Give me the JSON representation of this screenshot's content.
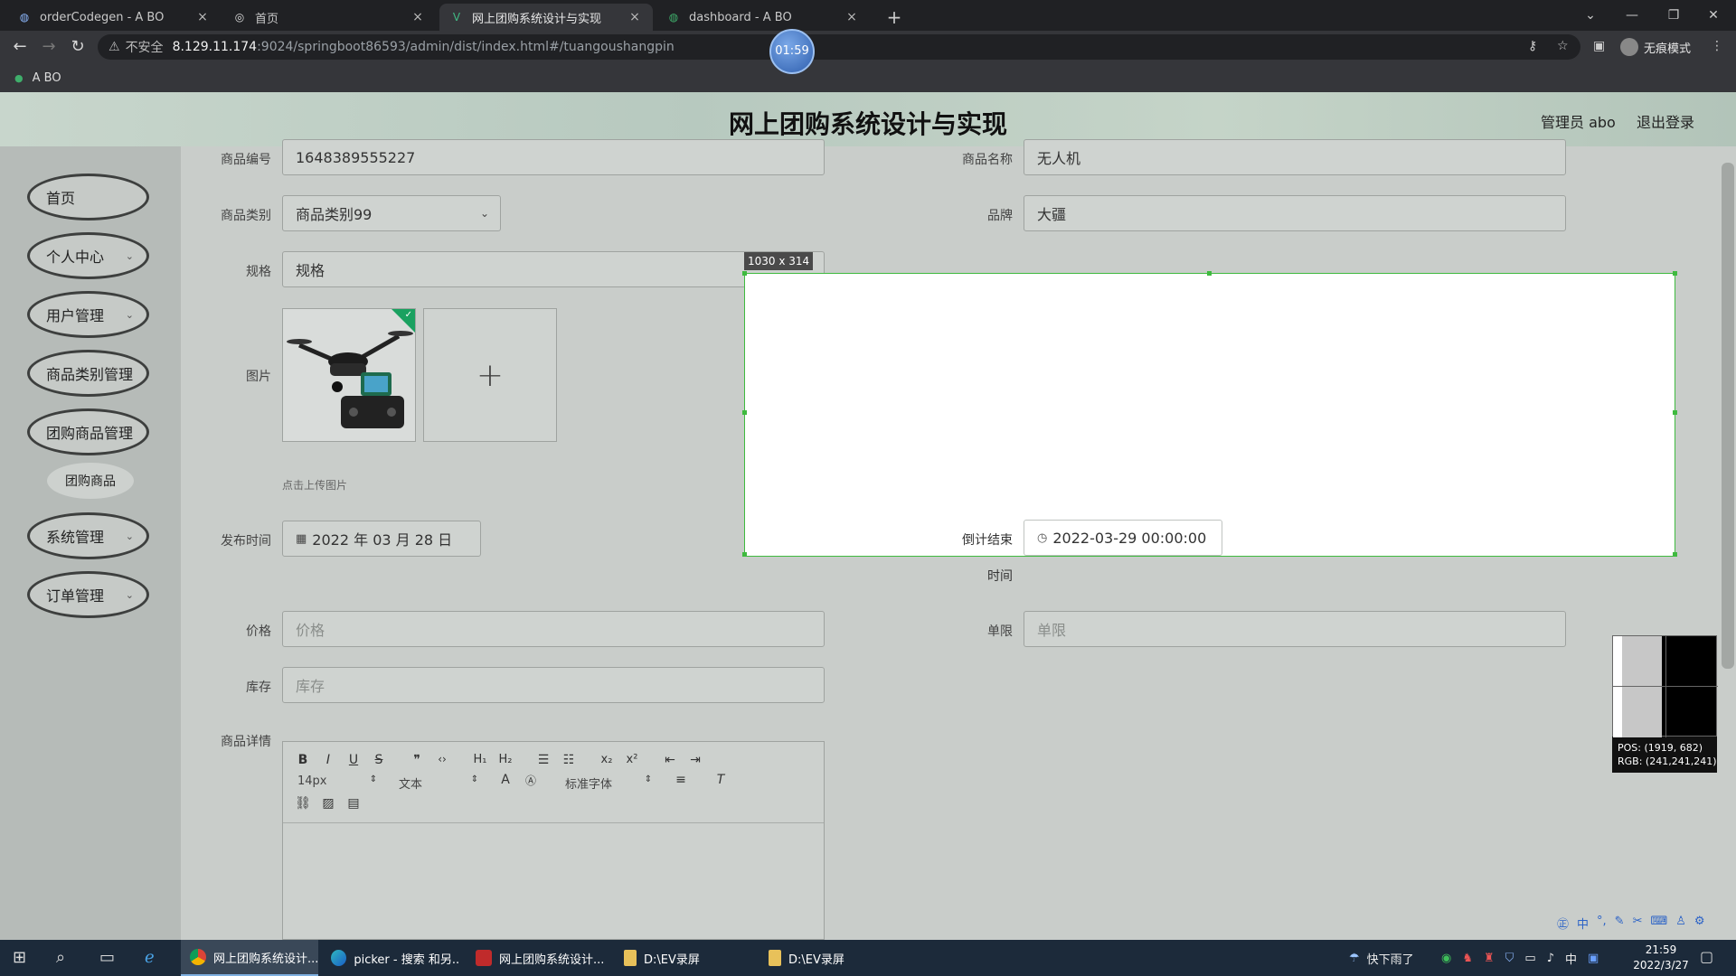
{
  "browser": {
    "tabs": [
      {
        "title": "orderCodegen - A BO",
        "close": "×"
      },
      {
        "title": "首页",
        "close": "×"
      },
      {
        "title": "网上团购系统设计与实现",
        "close": "×"
      },
      {
        "title": "dashboard - A BO",
        "close": "×"
      }
    ],
    "new_tab": "+",
    "url_warning": "不安全",
    "url_host": "8.129.11.174",
    "url_path": ":9024/springboot86593/admin/dist/index.html#/tuangoushangpin",
    "incognito_label": "无痕模式",
    "bookmark": "A BO",
    "timer": "01:59"
  },
  "header": {
    "title": "网上团购系统设计与实现",
    "admin": "管理员 abo",
    "logout": "退出登录"
  },
  "sidebar": {
    "items": [
      {
        "label": "首页"
      },
      {
        "label": "个人中心"
      },
      {
        "label": "用户管理"
      },
      {
        "label": "商品类别管理"
      },
      {
        "label": "团购商品管理"
      },
      {
        "label": "团购商品"
      },
      {
        "label": "系统管理"
      },
      {
        "label": "订单管理"
      }
    ]
  },
  "form": {
    "code_label": "商品编号",
    "code_value": "1648389555227",
    "name_label": "商品名称",
    "name_value": "无人机",
    "category_label": "商品类别",
    "category_value": "商品类别99",
    "brand_label": "品牌",
    "brand_value": "大疆",
    "spec_label": "规格",
    "spec_value": "规格",
    "image_label": "图片",
    "upload_tip": "点击上传图片",
    "publish_label": "发布时间",
    "publish_value": "2022 年 03 月 28 日",
    "countdown_label": "倒计结束",
    "countdown_label2": "时间",
    "countdown_value": "2022-03-29 00:00:00",
    "price_label": "价格",
    "price_placeholder": "价格",
    "limit_label": "单限",
    "limit_placeholder": "单限",
    "stock_label": "库存",
    "stock_placeholder": "库存",
    "detail_label": "商品详情"
  },
  "editor": {
    "size": "14px",
    "format": "文本",
    "font": "标准字体"
  },
  "selection": {
    "size_label": "1030 x 314"
  },
  "magnifier": {
    "pos": "POS:  (1919, 682)",
    "rgb": "RGB:  (241,241,241)"
  },
  "taskbar": {
    "tasks": [
      {
        "label": "网上团购系统设计..."
      },
      {
        "label": "picker - 搜索 和另..."
      },
      {
        "label": "网上团购系统设计..."
      },
      {
        "label": "D:\\EV录屏"
      },
      {
        "label": "D:\\EV录屏"
      }
    ],
    "weather": "快下雨了",
    "ime": "中",
    "time": "21:59",
    "date": "2022/3/27"
  },
  "colors": {
    "selection_border": "#3fba3f",
    "upload_check": "#1aa160"
  }
}
